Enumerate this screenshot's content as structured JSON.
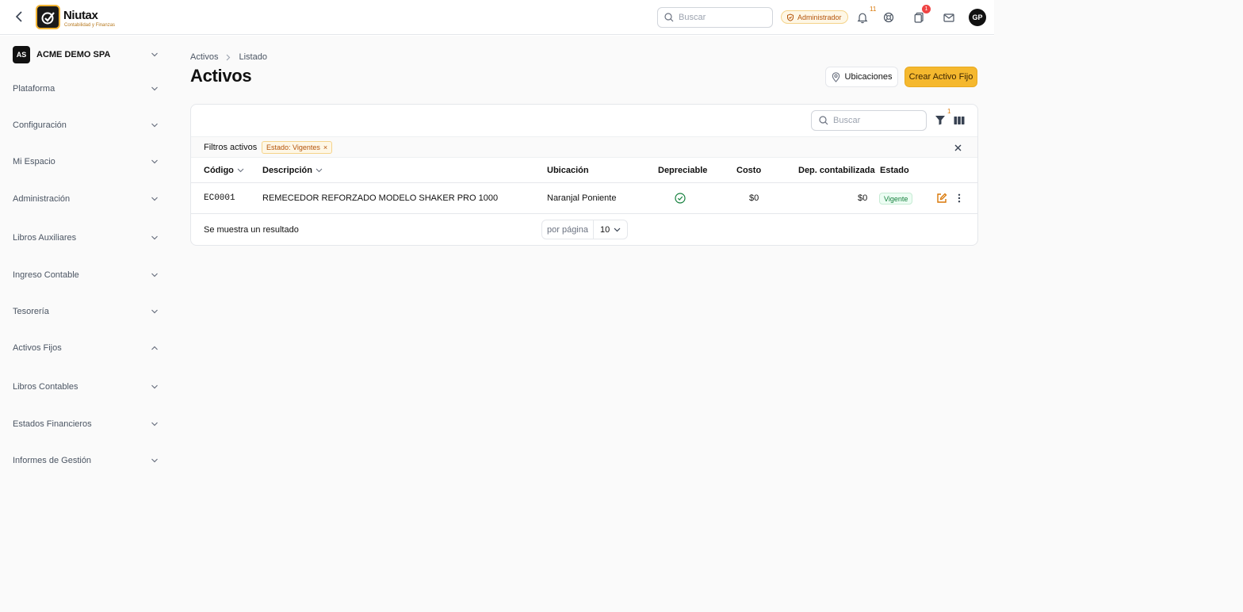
{
  "header": {
    "brand_name": "Niutax",
    "brand_tagline": "Contabilidad y Finanzas",
    "search_placeholder": "Buscar",
    "role_badge": "Administrador",
    "notifications_count": "11",
    "tasks_count": "1",
    "avatar_initials": "GP"
  },
  "sidebar": {
    "company_initials": "AS",
    "company_name": "ACME DEMO SPA",
    "items": [
      {
        "label": "Plataforma",
        "expanded": false
      },
      {
        "label": "Configuración",
        "expanded": false
      },
      {
        "label": "Mi Espacio",
        "expanded": false
      },
      {
        "label": "Administración",
        "expanded": false
      },
      {
        "label": "Libros Auxiliares",
        "expanded": false
      },
      {
        "label": "Ingreso Contable",
        "expanded": false
      },
      {
        "label": "Tesorería",
        "expanded": false
      },
      {
        "label": "Activos Fijos",
        "expanded": true
      },
      {
        "label": "Libros Contables",
        "expanded": false
      },
      {
        "label": "Estados Financieros",
        "expanded": false
      },
      {
        "label": "Informes de Gestión",
        "expanded": false
      }
    ]
  },
  "breadcrumb": [
    "Activos",
    "Listado"
  ],
  "page": {
    "title": "Activos",
    "locations_button": "Ubicaciones",
    "create_button": "Crear Activo Fijo"
  },
  "table": {
    "search_placeholder": "Buscar",
    "filter_count": "1",
    "active_filters_label": "Filtros activos",
    "filter_chip": "Estado: Vigentes",
    "columns": [
      "Código",
      "Descripción",
      "Ubicación",
      "Depreciable",
      "Costo",
      "Dep. contabilizada",
      "Estado"
    ],
    "rows": [
      {
        "codigo": "EC0001",
        "descripcion": "REMECEDOR REFORZADO MODELO SHAKER PRO 1000",
        "ubicacion": "Naranjal Poniente",
        "depreciable": true,
        "costo": "$0",
        "dep_contabilizada": "$0",
        "estado": "Vigente"
      }
    ],
    "result_text": "Se muestra un resultado",
    "per_page_label": "por página",
    "per_page_value": "10"
  },
  "colors": {
    "accent": "#f5b82e",
    "success": "#15803d"
  }
}
